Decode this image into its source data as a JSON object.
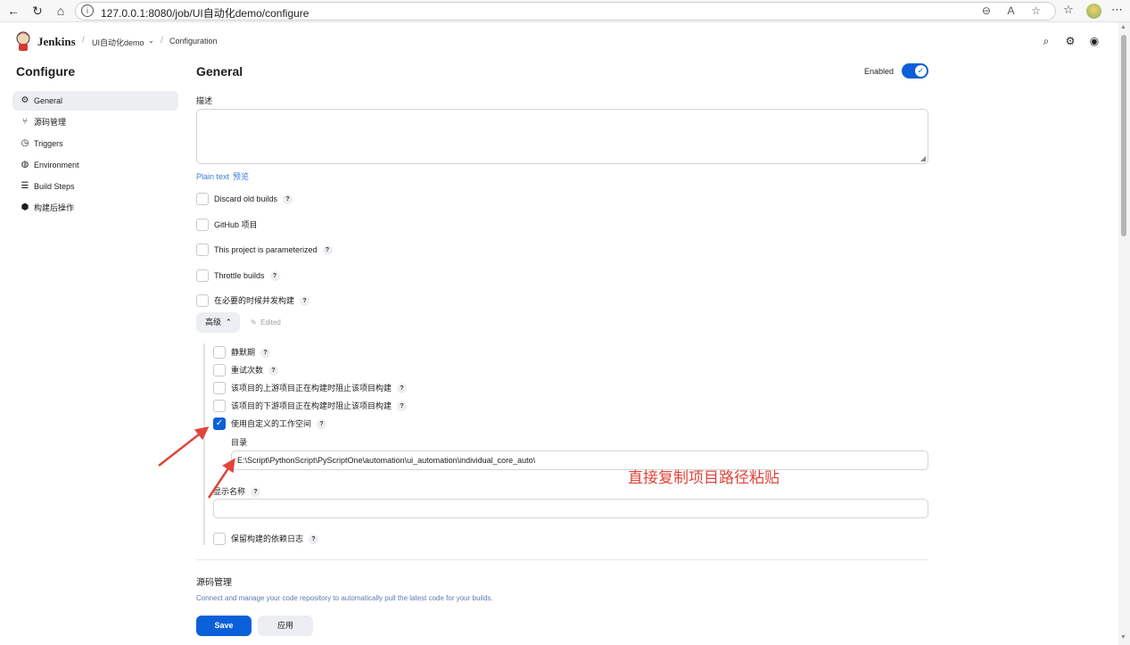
{
  "browser": {
    "url": "127.0.0.1:8080/job/UI自动化demo/configure",
    "back_icon": "arrow-left-icon",
    "refresh_icon": "refresh-icon",
    "home_icon": "home-icon"
  },
  "header": {
    "brand": "Jenkins",
    "breadcrumbs": [
      "UI自动化demo",
      "Configuration"
    ]
  },
  "sidebar": {
    "title": "Configure",
    "items": [
      {
        "label": "General",
        "icon": "gear-icon",
        "active": true
      },
      {
        "label": "源码管理",
        "icon": "branch-icon",
        "active": false
      },
      {
        "label": "Triggers",
        "icon": "clock-icon",
        "active": false
      },
      {
        "label": "Environment",
        "icon": "globe-icon",
        "active": false
      },
      {
        "label": "Build Steps",
        "icon": "list-icon",
        "active": false
      },
      {
        "label": "构建后操作",
        "icon": "package-icon",
        "active": false
      }
    ]
  },
  "general": {
    "title": "General",
    "enabled_label": "Enabled",
    "enabled": true,
    "description_label": "描述",
    "description_value": "",
    "plain_text": "Plain text",
    "preview": "预览",
    "options": [
      {
        "label": "Discard old builds",
        "checked": false,
        "help": true
      },
      {
        "label": "GitHub 项目",
        "checked": false,
        "help": false
      },
      {
        "label": "This project is parameterized",
        "checked": false,
        "help": true
      },
      {
        "label": "Throttle builds",
        "checked": false,
        "help": true
      },
      {
        "label": "在必要的时候并发构建",
        "checked": false,
        "help": true
      }
    ],
    "advanced_label": "高级",
    "edited_label": "Edited",
    "advanced_options": [
      {
        "label": "静默期",
        "checked": false
      },
      {
        "label": "重试次数",
        "checked": false
      },
      {
        "label": "该项目的上游项目正在构建时阻止该项目构建",
        "checked": false
      },
      {
        "label": "该项目的下游项目正在构建时阻止该项目构建",
        "checked": false
      },
      {
        "label": "使用自定义的工作空间",
        "checked": true
      }
    ],
    "directory_label": "目录",
    "directory_value": "E:\\Script\\PythonScript\\PyScriptOne\\automation\\ui_automation\\individual_core_auto\\",
    "display_name_label": "显示名称",
    "display_name_value": "",
    "keep_log_label": "保留构建的依赖日志",
    "keep_log_checked": false
  },
  "annotation": {
    "text": "直接复制项目路径粘贴",
    "color": "#e0453c"
  },
  "scm": {
    "title": "源码管理",
    "description": "Connect and manage your code repository to automatically pull the latest code for your builds."
  },
  "footer": {
    "save_label": "Save",
    "apply_label": "应用"
  },
  "colors": {
    "accent": "#0b5fd9",
    "link": "#3d7fd6"
  }
}
